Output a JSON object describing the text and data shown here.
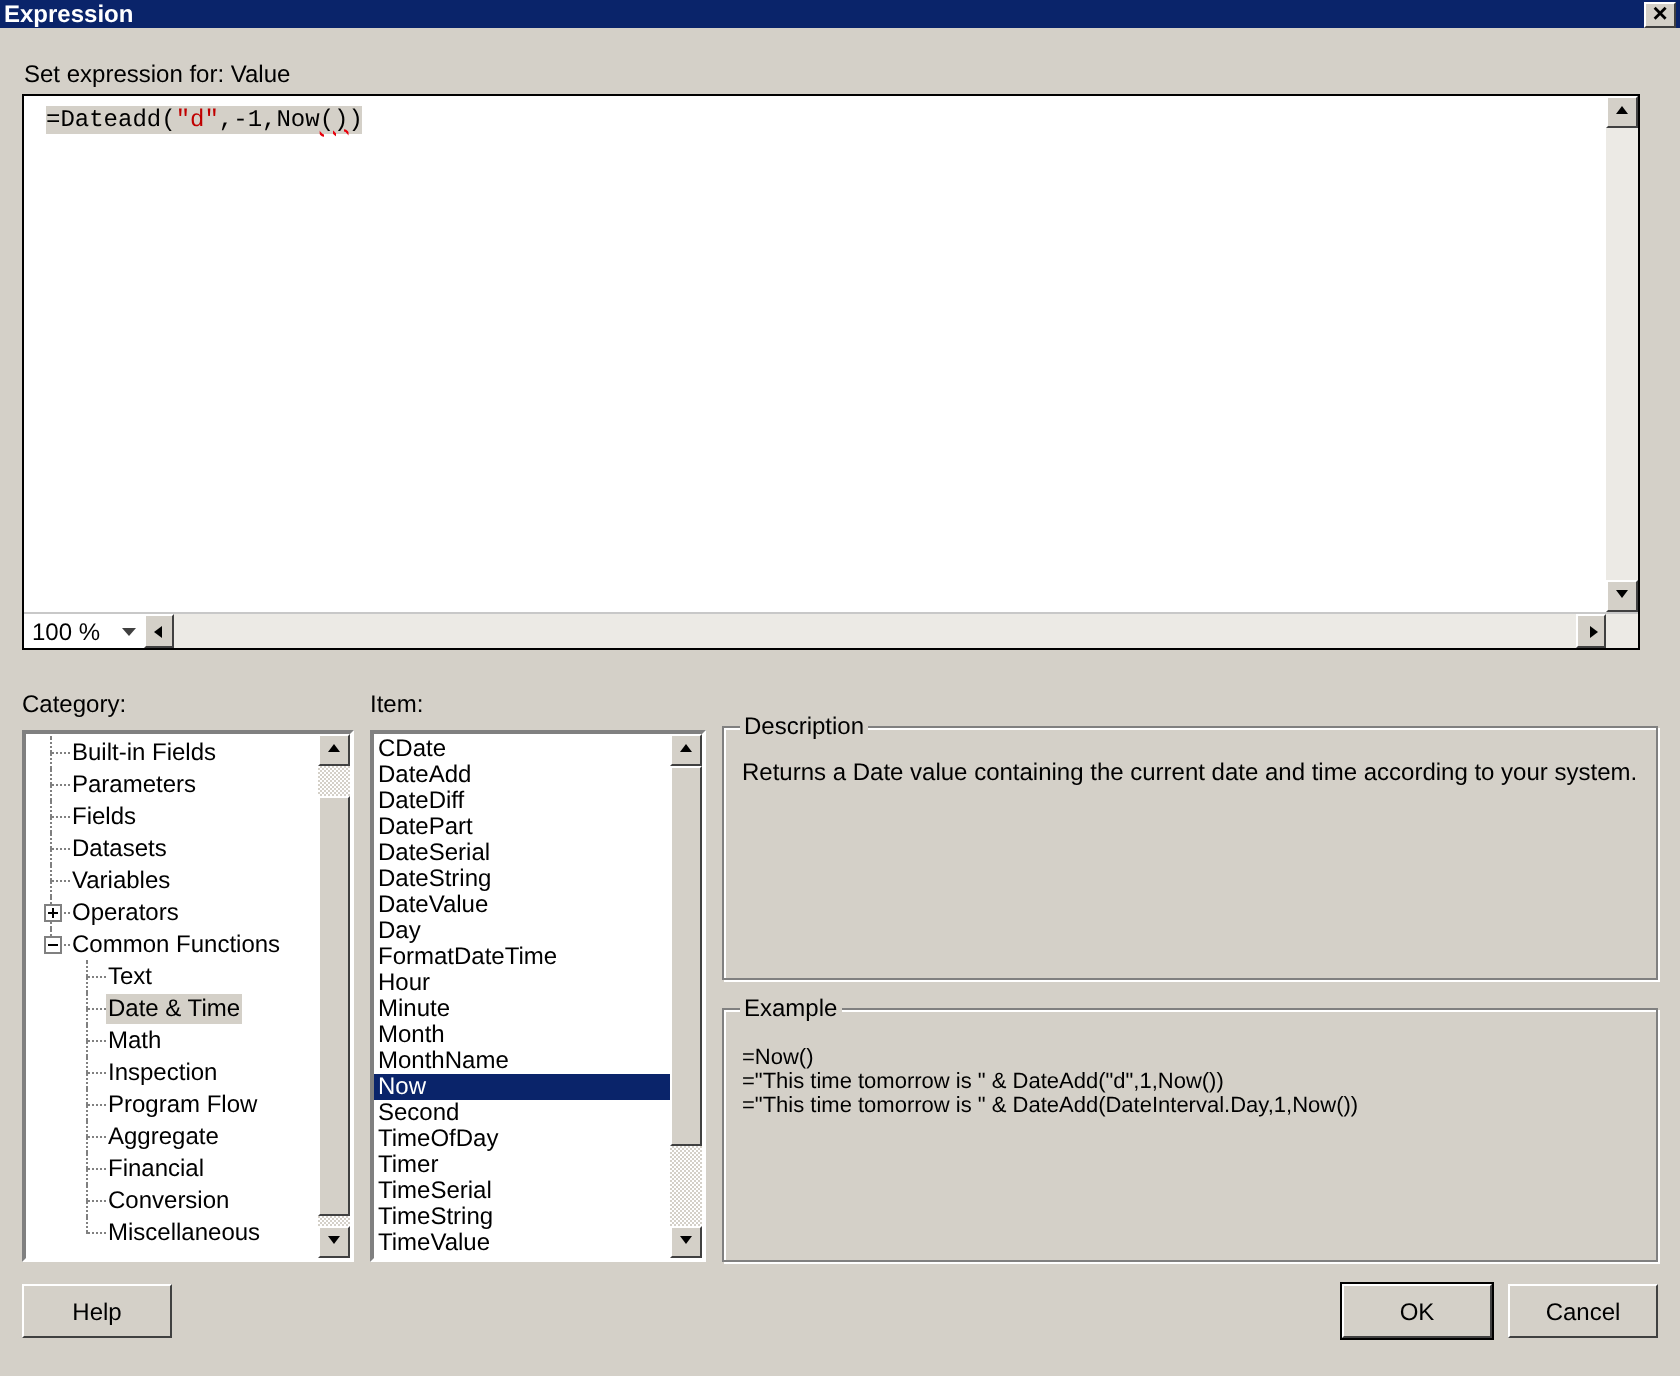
{
  "window": {
    "title": "Expression",
    "close": "×"
  },
  "prompt": "Set expression for: Value",
  "expression": [
    {
      "text": "=Dateadd(",
      "kind": "plain"
    },
    {
      "text": "\"d\"",
      "kind": "string"
    },
    {
      "text": ",-1,Now",
      "kind": "plain"
    },
    {
      "text": "()",
      "kind": "error"
    },
    {
      "text": ")",
      "kind": "plain"
    }
  ],
  "zoom": {
    "value": "100 %"
  },
  "category": {
    "label": "Category:",
    "items": [
      {
        "label": "Built-in Fields",
        "selected": false
      },
      {
        "label": "Parameters",
        "selected": false
      },
      {
        "label": "Fields",
        "selected": false
      },
      {
        "label": "Datasets",
        "selected": false
      },
      {
        "label": "Variables",
        "selected": false
      },
      {
        "label": "Operators",
        "selected": false,
        "expanded": false
      },
      {
        "label": "Common Functions",
        "selected": false,
        "expanded": true,
        "children": [
          {
            "label": "Text",
            "selected": false
          },
          {
            "label": "Date & Time",
            "selected": true
          },
          {
            "label": "Math",
            "selected": false
          },
          {
            "label": "Inspection",
            "selected": false
          },
          {
            "label": "Program Flow",
            "selected": false
          },
          {
            "label": "Aggregate",
            "selected": false
          },
          {
            "label": "Financial",
            "selected": false
          },
          {
            "label": "Conversion",
            "selected": false
          },
          {
            "label": "Miscellaneous",
            "selected": false
          }
        ]
      }
    ]
  },
  "item": {
    "label": "Item:",
    "items": [
      {
        "label": "CDate",
        "selected": false
      },
      {
        "label": "DateAdd",
        "selected": false
      },
      {
        "label": "DateDiff",
        "selected": false
      },
      {
        "label": "DatePart",
        "selected": false
      },
      {
        "label": "DateSerial",
        "selected": false
      },
      {
        "label": "DateString",
        "selected": false
      },
      {
        "label": "DateValue",
        "selected": false
      },
      {
        "label": "Day",
        "selected": false
      },
      {
        "label": "FormatDateTime",
        "selected": false
      },
      {
        "label": "Hour",
        "selected": false
      },
      {
        "label": "Minute",
        "selected": false
      },
      {
        "label": "Month",
        "selected": false
      },
      {
        "label": "MonthName",
        "selected": false
      },
      {
        "label": "Now",
        "selected": true
      },
      {
        "label": "Second",
        "selected": false
      },
      {
        "label": "TimeOfDay",
        "selected": false
      },
      {
        "label": "Timer",
        "selected": false
      },
      {
        "label": "TimeSerial",
        "selected": false
      },
      {
        "label": "TimeString",
        "selected": false
      },
      {
        "label": "TimeValue",
        "selected": false
      }
    ]
  },
  "description": {
    "title": "Description",
    "text": "Returns a Date value containing the current date and time according to your system."
  },
  "example": {
    "title": "Example",
    "lines": [
      "=Now()",
      "=\"This time tomorrow is \" & DateAdd(\"d\",1,Now())",
      "=\"This time tomorrow is \" & DateAdd(DateInterval.Day,1,Now())"
    ]
  },
  "buttons": [
    {
      "label": "Help",
      "default": false
    },
    {
      "label": "OK",
      "default": true
    },
    {
      "label": "Cancel",
      "default": false
    }
  ]
}
